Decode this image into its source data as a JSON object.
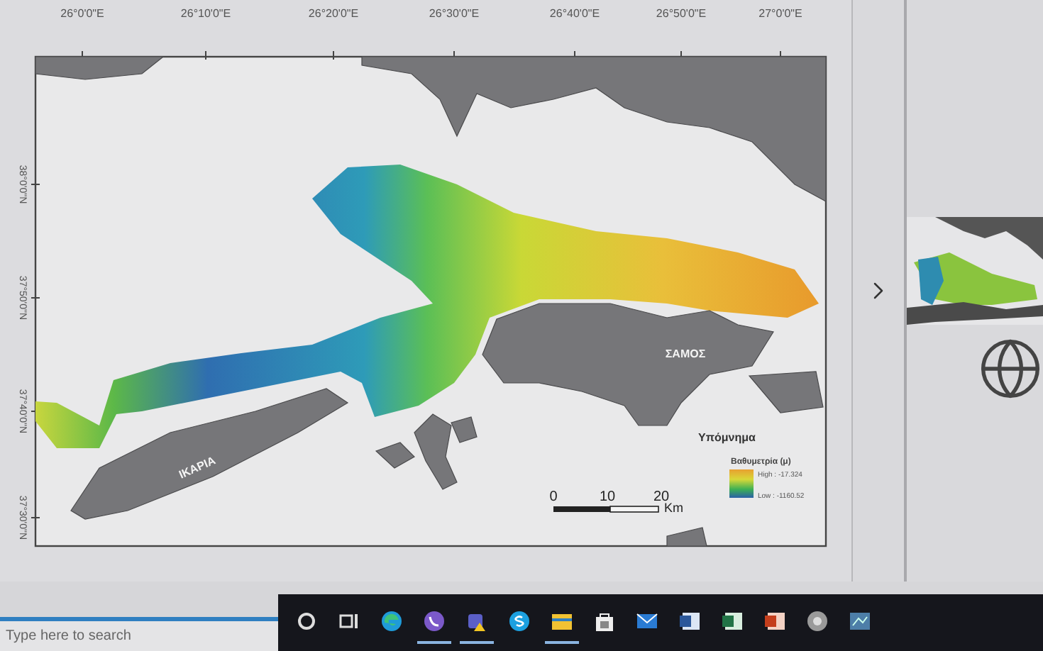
{
  "map": {
    "top_ticks": [
      "26°0'0\"E",
      "26°10'0\"E",
      "26°20'0\"E",
      "26°30'0\"E",
      "26°40'0\"E",
      "26°50'0\"E",
      "27°0'0\"E"
    ],
    "left_ticks": [
      "38°0'0\"N",
      "37°50'0\"N",
      "37°40'0\"N",
      "37°30'0\"N"
    ],
    "place_labels": [
      {
        "kind": "samos",
        "text": "ΣΑΜΟΣ"
      },
      {
        "kind": "ikaria",
        "text": "ΙΚΑΡΙΑ"
      }
    ],
    "legend": {
      "title": "Υπόμνημα",
      "subtitle": "Βαθυμετρία (μ)",
      "high": "High : -17.324",
      "low": "Low : -1160.52"
    },
    "scale_bar": {
      "labels": [
        "0",
        "10",
        "20"
      ],
      "unit": "Km"
    }
  },
  "taskbar": {
    "search": {
      "placeholder": "Type here to search"
    },
    "apps": [
      {
        "kind": "cortana",
        "active": false
      },
      {
        "kind": "taskview",
        "active": false
      },
      {
        "kind": "edge",
        "active": false
      },
      {
        "kind": "viber",
        "active": true
      },
      {
        "kind": "teams",
        "active": true
      },
      {
        "kind": "skype",
        "active": false
      },
      {
        "kind": "explorer",
        "active": true
      },
      {
        "kind": "store",
        "active": false
      },
      {
        "kind": "mail",
        "active": false
      },
      {
        "kind": "word",
        "active": false
      },
      {
        "kind": "excel",
        "active": false
      },
      {
        "kind": "powerpoint",
        "active": false
      },
      {
        "kind": "chrome",
        "active": false
      },
      {
        "kind": "snip",
        "active": false
      }
    ]
  }
}
